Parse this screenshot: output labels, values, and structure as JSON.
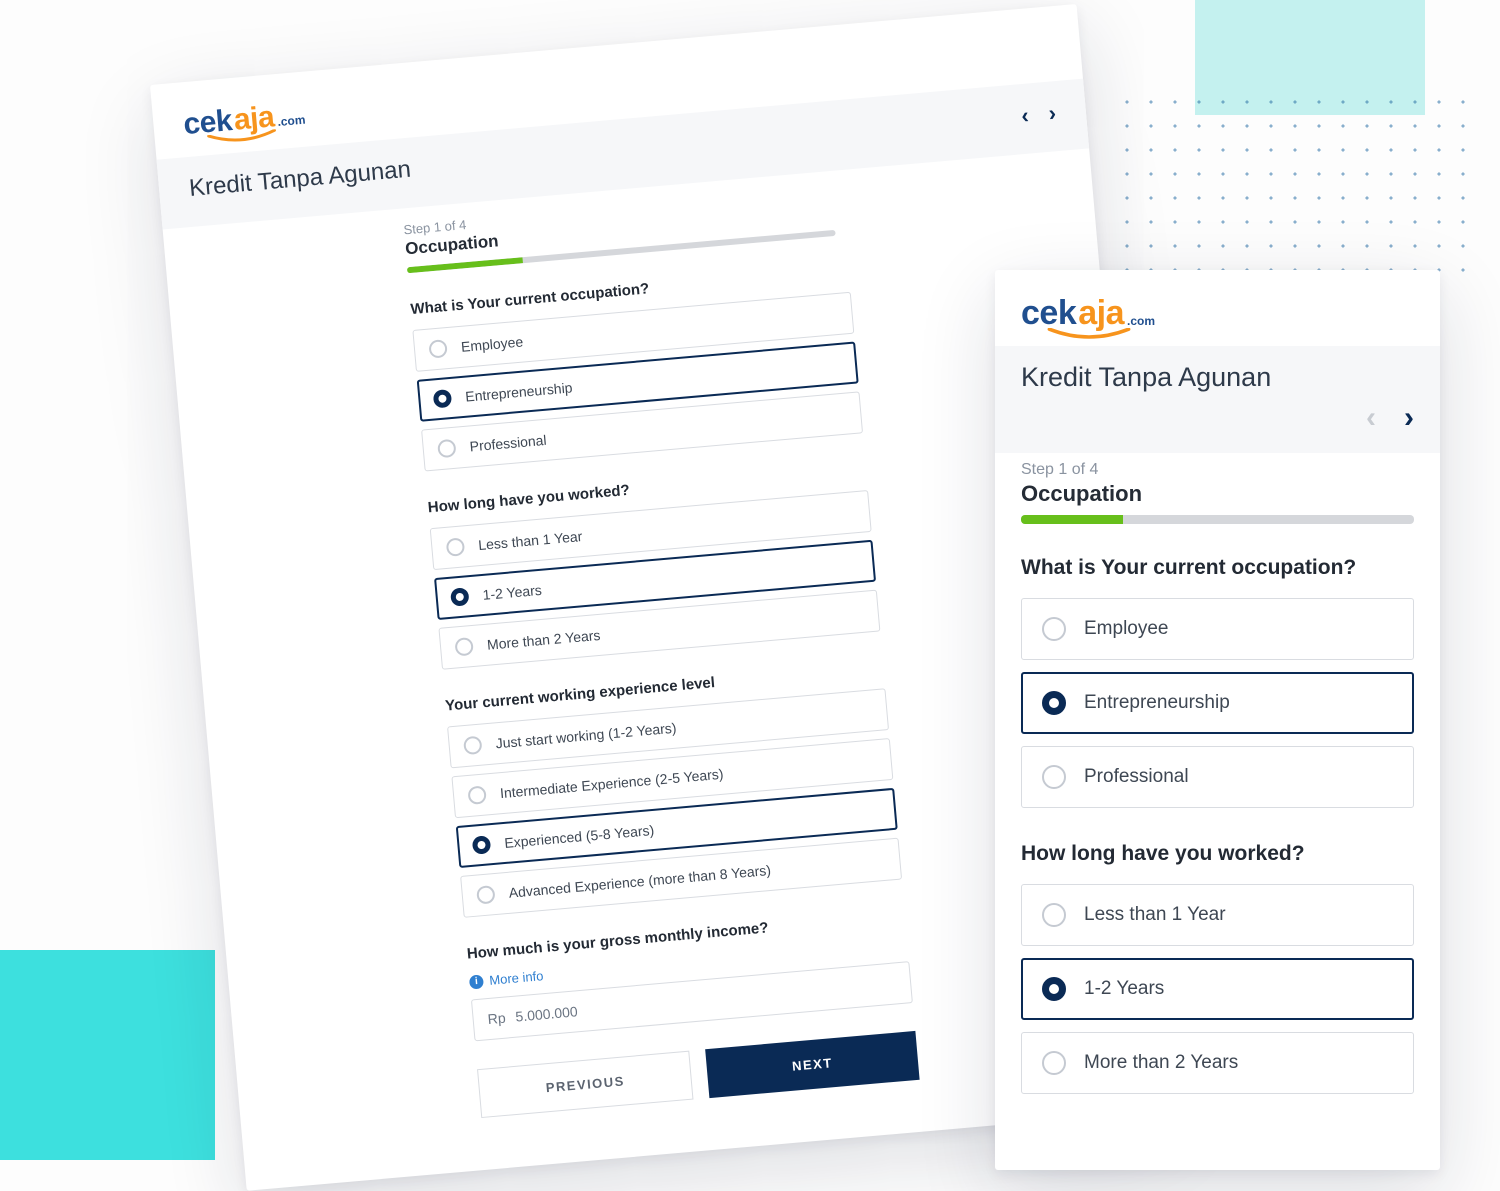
{
  "brand": {
    "part1": "cek",
    "part2": "aja",
    "suffix": ".com"
  },
  "page": {
    "title": "Kredit Tanpa Agunan",
    "step_n": "Step 1 of 4",
    "step_name": "Occupation"
  },
  "nav": {
    "prev_icon": "chevron-left",
    "next_icon": "chevron-right",
    "prev_disabled_mobile": true
  },
  "progress": {
    "pct_desktop": "27%",
    "pct_mobile": "26%"
  },
  "d": {
    "q1": {
      "label": "What is Your current occupation?",
      "opts": [
        "Employee",
        "Entrepreneurship",
        "Professional"
      ],
      "sel": 1
    },
    "q2": {
      "label": "How long have you worked?",
      "opts": [
        "Less than 1 Year",
        "1-2 Years",
        "More than 2 Years"
      ],
      "sel": 1
    },
    "q3": {
      "label": "Your current working experience level",
      "opts": [
        "Just start working (1-2 Years)",
        "Intermediate Experience (2-5 Years)",
        "Experienced (5-8 Years)",
        "Advanced Experience (more than 8 Years)"
      ],
      "sel": 2
    },
    "q4": {
      "label": "How much is your gross monthly income?",
      "more_info": "More info",
      "prefix": "Rp",
      "value": "5.000.000"
    },
    "btn_prev": "PREVIOUS",
    "btn_next": "NEXT"
  },
  "m": {
    "q1": {
      "label": "What is Your current occupation?",
      "opts": [
        "Employee",
        "Entrepreneurship",
        "Professional"
      ],
      "sel": 1
    },
    "q2": {
      "label": "How long have you worked?",
      "opts": [
        "Less than 1 Year",
        "1-2 Years",
        "More than 2 Years"
      ],
      "sel": 1
    }
  }
}
